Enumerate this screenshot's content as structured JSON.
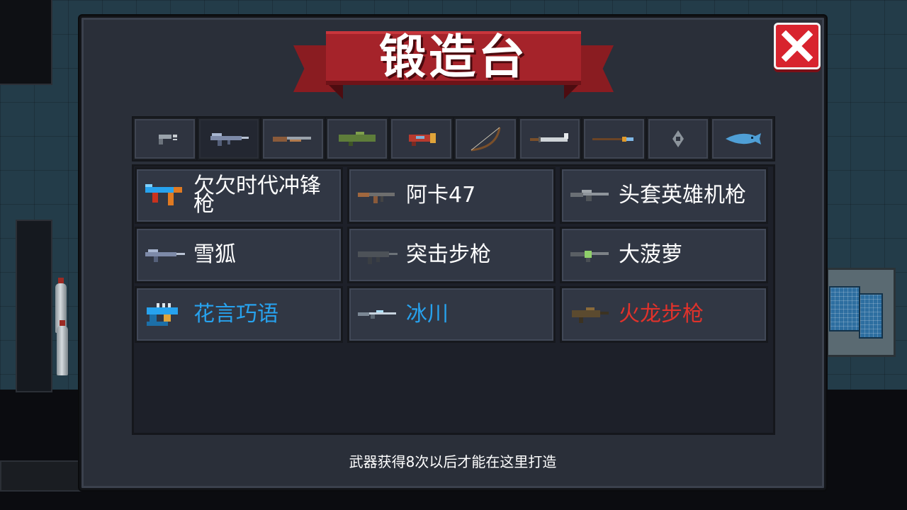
{
  "title": "锻造台",
  "close_label": "close",
  "tabs": [
    {
      "icon": "pistol-icon",
      "active": false
    },
    {
      "icon": "rifle-icon",
      "active": true
    },
    {
      "icon": "shotgun-icon",
      "active": false
    },
    {
      "icon": "launcher-icon",
      "active": false
    },
    {
      "icon": "laser-gun-icon",
      "active": false
    },
    {
      "icon": "bow-icon",
      "active": false
    },
    {
      "icon": "sword-icon",
      "active": false
    },
    {
      "icon": "spear-icon",
      "active": false
    },
    {
      "icon": "shuriken-icon",
      "active": false
    },
    {
      "icon": "fish-icon",
      "active": false
    }
  ],
  "weapons": [
    {
      "name": "欠欠时代冲锋枪",
      "color": "#ffffff",
      "icon": "smg-icon"
    },
    {
      "name": "阿卡47",
      "color": "#ffffff",
      "icon": "ak47-icon"
    },
    {
      "name": "头套英雄机枪",
      "color": "#ffffff",
      "icon": "machine-gun-icon"
    },
    {
      "name": "雪狐",
      "color": "#ffffff",
      "icon": "snow-fox-rifle-icon"
    },
    {
      "name": "突击步枪",
      "color": "#ffffff",
      "icon": "assault-rifle-icon"
    },
    {
      "name": "大菠萝",
      "color": "#ffffff",
      "icon": "pineapple-rifle-icon"
    },
    {
      "name": "花言巧语",
      "color": "#27a2ee",
      "icon": "sweet-talk-gun-icon"
    },
    {
      "name": "冰川",
      "color": "#27a2ee",
      "icon": "glacier-rifle-icon"
    },
    {
      "name": "火龙步枪",
      "color": "#e0322b",
      "icon": "fire-dragon-rifle-icon"
    }
  ],
  "footer_note": "武器获得8次以后才能在这里打造"
}
